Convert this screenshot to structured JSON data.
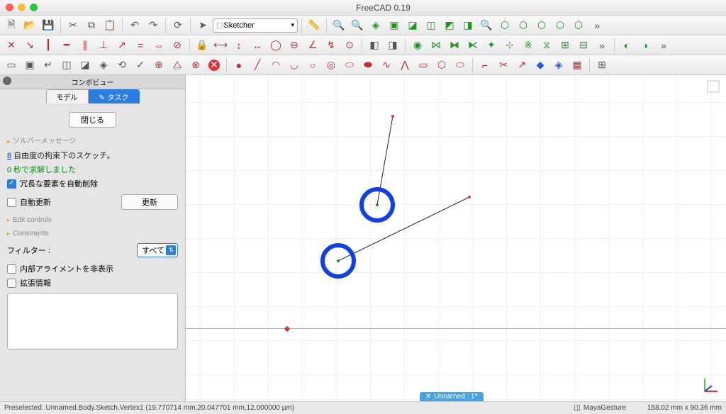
{
  "window": {
    "title": "FreeCAD 0.19"
  },
  "workbench": {
    "selected": "Sketcher"
  },
  "combo": {
    "title": "コンボビュー",
    "tab_model": "モデル",
    "tab_task": "タスク"
  },
  "task": {
    "close": "閉じる",
    "solver_header": "ソルバーメッセージ",
    "dof_prefix": "8",
    "dof_text": " 自由度の拘束下のスケッチ。",
    "solved": "0 秒で求解しました",
    "auto_remove": "冗長な要素を自動削除",
    "auto_update": "自動更新",
    "update_btn": "更新",
    "edit_header": "Edit controls",
    "constraints_header": "Constraints",
    "filter_label": "フィルター :",
    "filter_value": "すべて",
    "hide_align": "内部アライメントを非表示",
    "ext_info": "拡張情報"
  },
  "document": {
    "active_tab": "Unnamed : 1*"
  },
  "status": {
    "preselect": "Preselected: Unnamed.Body.Sketch.Vertex1 (19.770714 mm,20.047701 mm,12.000000 µm)",
    "nav": "MayaGesture",
    "dims": "158.02 mm x 90.36 mm"
  }
}
